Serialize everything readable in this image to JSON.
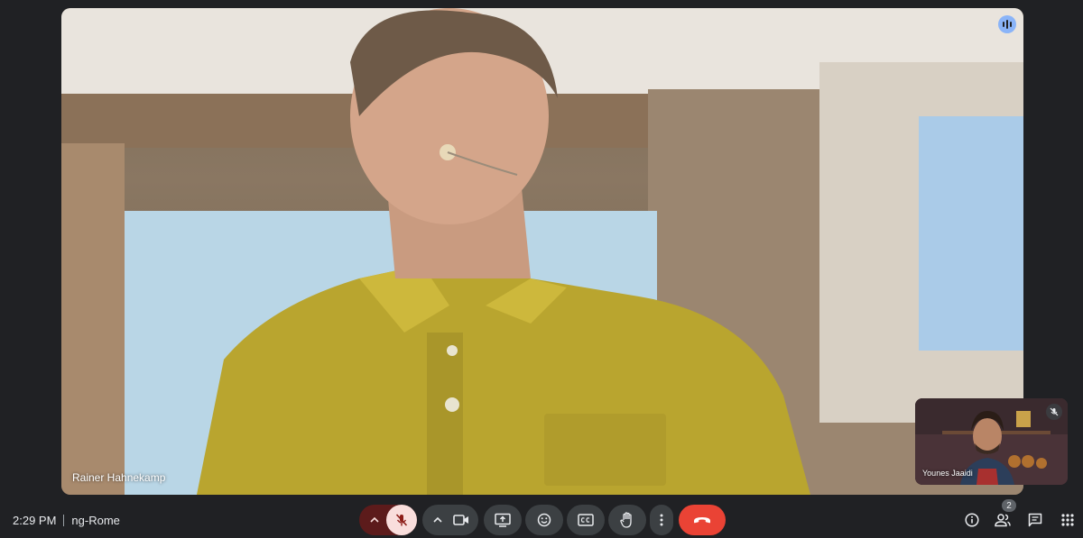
{
  "meeting": {
    "time": "2:29 PM",
    "name": "ng-Rome"
  },
  "main_video": {
    "participant_name": "Rainer Hahnekamp",
    "speaking_indicator_icon": "audio-level-icon"
  },
  "self_view": {
    "participant_name": "Younes Jaaidi",
    "mic_state_icon": "mic-off-icon"
  },
  "controls": {
    "mic_options_icon": "chevron-up-icon",
    "mic_icon": "mic-off-icon",
    "camera_options_icon": "chevron-up-icon",
    "camera_icon": "videocam-icon",
    "present_icon": "present-screen-icon",
    "reactions_icon": "emoji-icon",
    "captions_icon": "closed-captions-icon",
    "raise_hand_icon": "hand-icon",
    "more_icon": "more-vert-icon",
    "leave_icon": "call-end-icon"
  },
  "side_panel": {
    "info_icon": "info-icon",
    "people_icon": "people-icon",
    "people_count": "2",
    "chat_icon": "chat-icon",
    "activities_icon": "apps-grid-icon"
  },
  "colors": {
    "background": "#202124",
    "mic_muted_bg": "#f9dedc",
    "end_call": "#ea4335",
    "speaking_badge": "#8ab4f8"
  }
}
